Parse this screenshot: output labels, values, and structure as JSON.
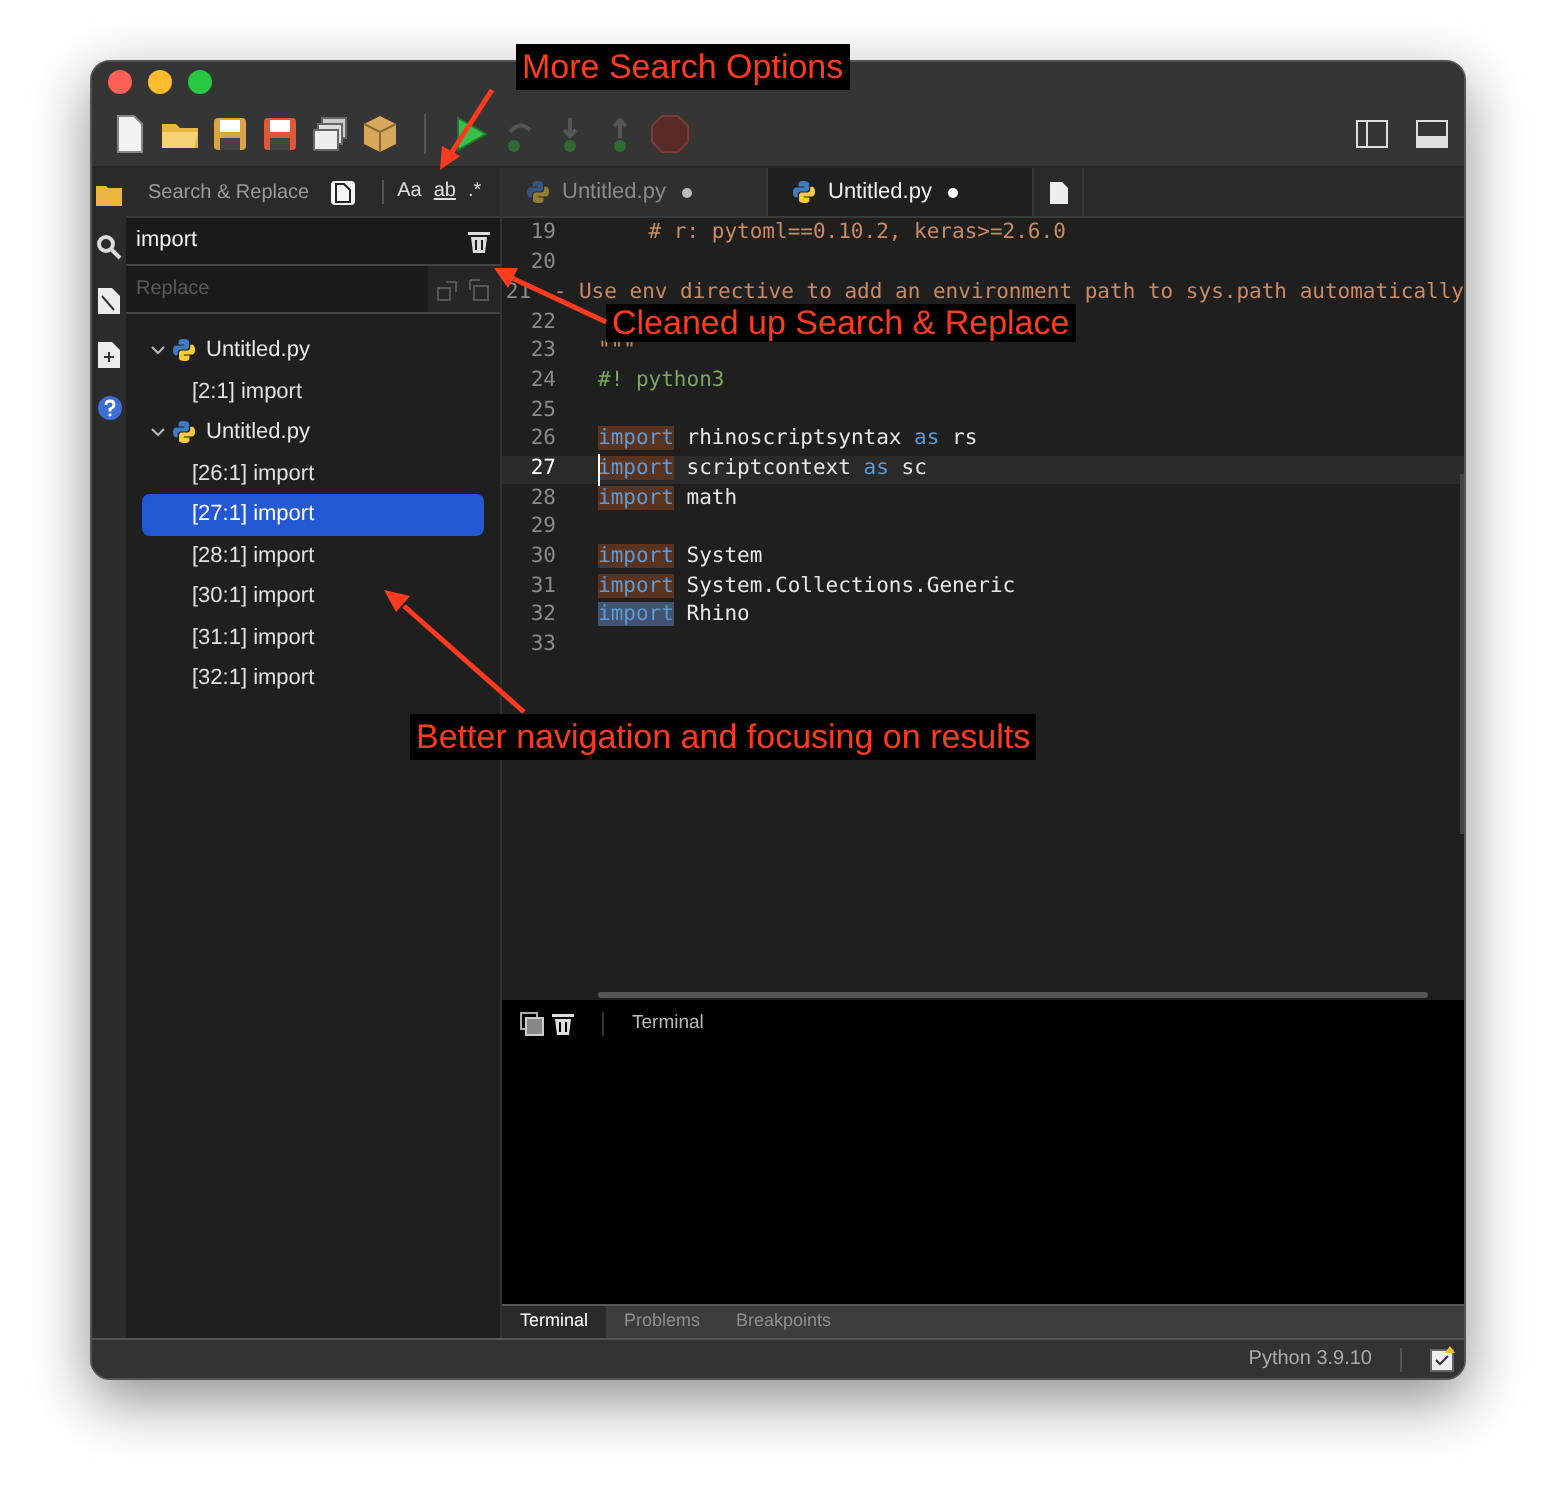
{
  "search_panel": {
    "title": "Search & Replace",
    "options": [
      {
        "label": "Aa",
        "underline": false
      },
      {
        "label": "ab",
        "underline": true
      },
      {
        "label": ".*",
        "underline": false
      }
    ],
    "search": {
      "value": "import"
    },
    "replace": {
      "placeholder": "Replace"
    },
    "results": [
      {
        "label": "Untitled.py",
        "expanded": true,
        "children": [
          {
            "label": "[2:1] import",
            "selected": false
          }
        ]
      },
      {
        "label": "Untitled.py",
        "expanded": true,
        "children": [
          {
            "label": "[26:1] import",
            "selected": false
          },
          {
            "label": "[27:1] import",
            "selected": true
          },
          {
            "label": "[28:1] import",
            "selected": false
          },
          {
            "label": "[30:1] import",
            "selected": false
          },
          {
            "label": "[31:1] import",
            "selected": false
          },
          {
            "label": "[32:1] import",
            "selected": false
          }
        ]
      }
    ]
  },
  "editor_tabs": [
    {
      "label": "Untitled.py",
      "selected": false,
      "modified": true
    },
    {
      "label": "Untitled.py",
      "selected": true,
      "modified": true
    }
  ],
  "code_lines": [
    {
      "number": "19",
      "current": false,
      "segments": [
        {
          "text": "    # r: pytoml==0.10.2, keras>=2.6.0",
          "kind": "docstring"
        }
      ]
    },
    {
      "number": "20",
      "current": false
    },
    {
      "number": "21",
      "current": false,
      "segments": [
        {
          "text": "- Use env directive to add an environment path to sys.path automatically",
          "kind": "docstring"
        }
      ]
    },
    {
      "number": "22",
      "current": false
    },
    {
      "number": "23",
      "current": false,
      "segments": [
        {
          "text": "\"\"\"",
          "kind": "docstring"
        }
      ]
    },
    {
      "number": "24",
      "current": false,
      "segments": [
        {
          "text": "#! python3",
          "kind": "comment"
        }
      ]
    },
    {
      "number": "25",
      "current": false
    },
    {
      "number": "26",
      "current": false,
      "segments": [
        {
          "text": "import",
          "kind": "keyword",
          "match": true,
          "active": false
        },
        {
          "text": " rhinoscriptsyntax ",
          "kind": "plain"
        },
        {
          "text": "as",
          "kind": "keyword"
        },
        {
          "text": " rs",
          "kind": "plain"
        }
      ]
    },
    {
      "number": "27",
      "current": true,
      "segments": [
        {
          "text": "import",
          "kind": "keyword",
          "match": true,
          "active": false
        },
        {
          "text": " scriptcontext ",
          "kind": "plain"
        },
        {
          "text": "as",
          "kind": "keyword"
        },
        {
          "text": " sc",
          "kind": "plain"
        }
      ]
    },
    {
      "number": "28",
      "current": false,
      "segments": [
        {
          "text": "import",
          "kind": "keyword",
          "match": true,
          "active": false
        },
        {
          "text": " math",
          "kind": "plain"
        }
      ]
    },
    {
      "number": "29",
      "current": false
    },
    {
      "number": "30",
      "current": false,
      "segments": [
        {
          "text": "import",
          "kind": "keyword",
          "match": true,
          "active": false
        },
        {
          "text": " System",
          "kind": "plain"
        }
      ]
    },
    {
      "number": "31",
      "current": false,
      "segments": [
        {
          "text": "import",
          "kind": "keyword",
          "match": true,
          "active": false
        },
        {
          "text": " System.Collections.Generic",
          "kind": "plain"
        }
      ]
    },
    {
      "number": "32",
      "current": false,
      "segments": [
        {
          "text": "import",
          "kind": "keyword",
          "match": true,
          "active": true
        },
        {
          "text": " Rhino",
          "kind": "plain"
        }
      ]
    },
    {
      "number": "33",
      "current": false
    }
  ],
  "terminal": {
    "title": "Terminal"
  },
  "bottom_tabs": [
    {
      "label": "Terminal",
      "selected": true
    },
    {
      "label": "Problems",
      "selected": false
    },
    {
      "label": "Breakpoints",
      "selected": false
    }
  ],
  "status_bar": {
    "interpreter": "Python 3.9.10"
  },
  "annotations": [
    {
      "text": "More Search Options"
    },
    {
      "text": "Cleaned up Search & Replace"
    },
    {
      "text": "Better navigation and focusing on results"
    }
  ]
}
